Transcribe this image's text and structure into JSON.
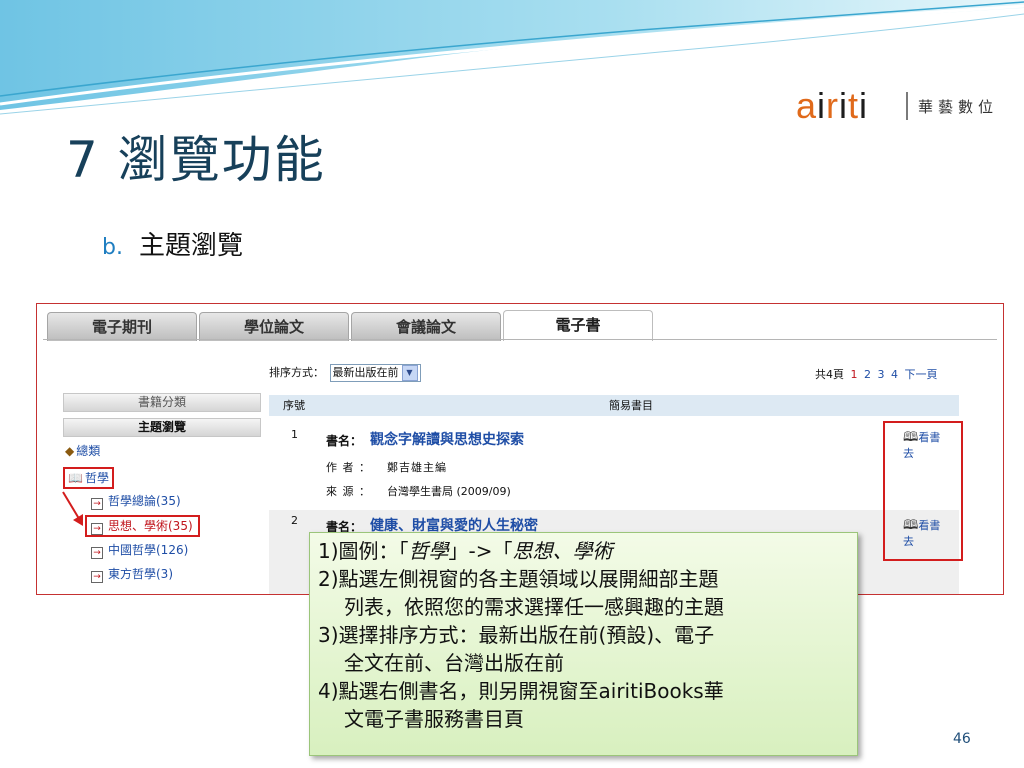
{
  "logo": {
    "part1": "a",
    "part2": "i",
    "part3": "r",
    "part4": "i",
    "part5": "t",
    "part6": "i",
    "tagline": "華藝數位"
  },
  "slide": {
    "title": "7 瀏覽功能",
    "subtitle_marker": "b.",
    "subtitle": "主題瀏覽",
    "page_number": "46"
  },
  "tabs": [
    {
      "label": "電子期刊"
    },
    {
      "label": "學位論文"
    },
    {
      "label": "會議論文"
    },
    {
      "label": "電子書",
      "active": true
    }
  ],
  "sort": {
    "label": "排序方式：",
    "selected": "最新出版在前"
  },
  "pager": {
    "total": "共4頁",
    "pages": [
      "1",
      "2",
      "3",
      "4"
    ],
    "current": "1",
    "next": "下一頁"
  },
  "category_panel": {
    "heading_classify": "書籍分類",
    "heading_browse": "主題瀏覽",
    "root": "總類",
    "expanded": "哲學",
    "children": [
      "哲學總論(35)",
      "思想、學術(35)",
      "中國哲學(126)",
      "東方哲學(3)"
    ]
  },
  "table": {
    "col_seq": "序號",
    "col_info": "簡易書目",
    "rows": [
      {
        "num": "1",
        "title_label": "書名：",
        "title": "觀念字解讀與思想史探索",
        "author_label": "作 者 ：",
        "author": "鄭吉雄主編",
        "source_label": "來 源 ：",
        "source": "台灣學生書局 (2009/09)",
        "read_label_1": "看書",
        "read_label_2": "去"
      },
      {
        "num": "2",
        "title_label": "書名：",
        "title": "健康、財富與愛的人生秘密",
        "read_label_1": "看書",
        "read_label_2": "去"
      }
    ]
  },
  "callout": {
    "l1_prefix": "1)圖例：「",
    "l1_em1": "哲學",
    "l1_mid": "」->「",
    "l1_em2": "思想、學術",
    "l2": "2)點選左側視窗的各主題領域以展開細部主題",
    "l2b": "列表，依照您的需求選擇任一感興趣的主題",
    "l3": "3)選擇排序方式：最新出版在前(預設)、電子",
    "l3b": "全文在前、台灣出版在前",
    "l4": "4)點選右側書名，則另開視窗至airitiBooks華",
    "l4b": "文電子書服務書目頁"
  },
  "colors": {
    "title": "#17405a",
    "highlight": "#d31d1d",
    "link": "#1f4ea6",
    "callout": "#e4f5d0"
  }
}
